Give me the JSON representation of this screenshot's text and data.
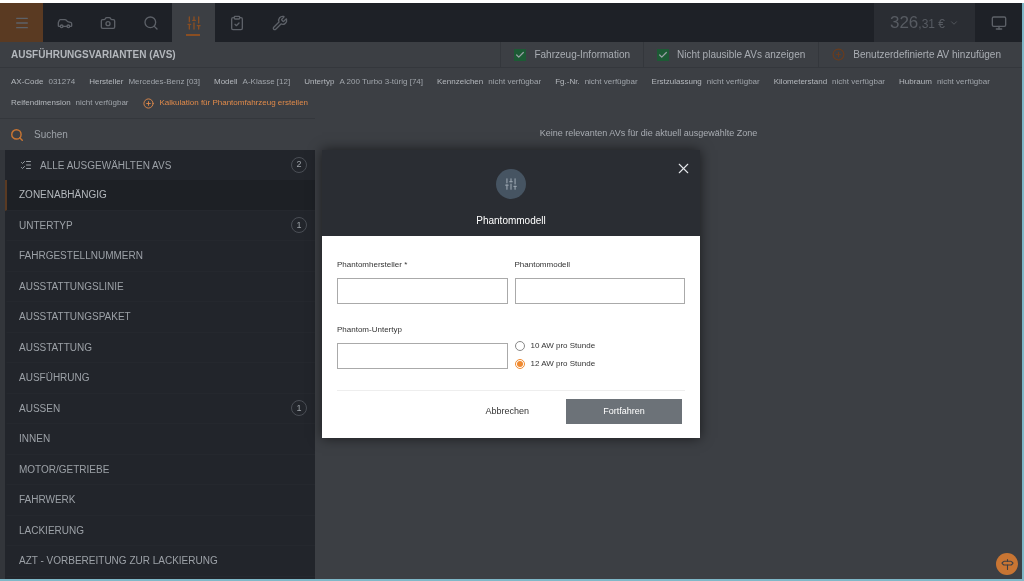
{
  "nav": {
    "tabs": [
      {
        "kind": "menu",
        "selected": false
      },
      {
        "kind": "car",
        "selected": false
      },
      {
        "kind": "camera",
        "selected": false
      },
      {
        "kind": "search",
        "selected": false
      },
      {
        "kind": "sliders",
        "selected": true
      },
      {
        "kind": "clipboard",
        "selected": false
      },
      {
        "kind": "tools",
        "selected": false
      }
    ],
    "price": {
      "main": "326",
      "small": ",31 €"
    }
  },
  "header": {
    "title": "AUSFÜHRUNGSVARIANTEN (AVS)",
    "options": [
      {
        "kind": "checkbox",
        "label": "Fahrzeug-Information",
        "checked": true
      },
      {
        "kind": "checkbox",
        "label": "Nicht plausible AVs anzeigen",
        "checked": true
      },
      {
        "kind": "add",
        "label": "Benutzerdefinierte AV hinzufügen"
      }
    ]
  },
  "info": {
    "fields": [
      {
        "label": "AX-Code",
        "value": "031274"
      },
      {
        "label": "Hersteller",
        "value": "Mercedes-Benz [03]"
      },
      {
        "label": "Modell",
        "value": "A-Klasse [12]"
      },
      {
        "label": "Untertyp",
        "value": "A 200 Turbo 3-türig [74]"
      },
      {
        "label": "Kennzeichen",
        "value": "nicht verfügbar"
      },
      {
        "label": "Fg.-Nr.",
        "value": "nicht verfügbar"
      },
      {
        "label": "Erstzulassung",
        "value": "nicht verfügbar"
      },
      {
        "label": "Kilometerstand",
        "value": "nicht verfügbar"
      },
      {
        "label": "Hubraum",
        "value": "nicht verfügbar"
      },
      {
        "label": "Reifendimension",
        "value": "nicht verfügbar"
      }
    ],
    "action": "Kalkulation für Phantomfahrzeug erstellen"
  },
  "search": {
    "placeholder": "Suchen"
  },
  "sidebar": {
    "header": {
      "label": "ALLE AUSGEWÄHLTEN AVS",
      "count": "2"
    },
    "items": [
      {
        "label": "ZONENABHÄNGIG",
        "selected": true
      },
      {
        "label": "UNTERTYP",
        "count": "1",
        "selected": false
      },
      {
        "label": "FAHRGESTELLNUMMERN",
        "selected": false
      },
      {
        "label": "AUSSTATTUNGSLINIE",
        "selected": false
      },
      {
        "label": "AUSSTATTUNGSPAKET",
        "selected": false
      },
      {
        "label": "AUSSTATTUNG",
        "selected": false
      },
      {
        "label": "AUSFÜHRUNG",
        "selected": false
      },
      {
        "label": "AUSSEN",
        "count": "1",
        "selected": false
      },
      {
        "label": "INNEN",
        "selected": false
      },
      {
        "label": "MOTOR/GETRIEBE",
        "selected": false
      },
      {
        "label": "FAHRWERK",
        "selected": false
      },
      {
        "label": "LACKIERUNG",
        "selected": false
      },
      {
        "label": "AZT - VORBEREITUNG ZUR LACKIERUNG",
        "selected": false
      }
    ]
  },
  "main": {
    "message": "Keine relevanten AVs für die aktuell ausgewählte Zone"
  },
  "dialog": {
    "title": "Phantommodell",
    "fields": [
      {
        "label": "Phantomhersteller *"
      },
      {
        "label": "Phantommodell"
      },
      {
        "label": "Phantom-Untertyp"
      }
    ],
    "radios": [
      {
        "label": "10 AW pro Stunde",
        "selected": false
      },
      {
        "label": "12 AW pro Stunde",
        "selected": true
      }
    ],
    "cancel": "Abbrechen",
    "confirm": "Fortfahren"
  }
}
